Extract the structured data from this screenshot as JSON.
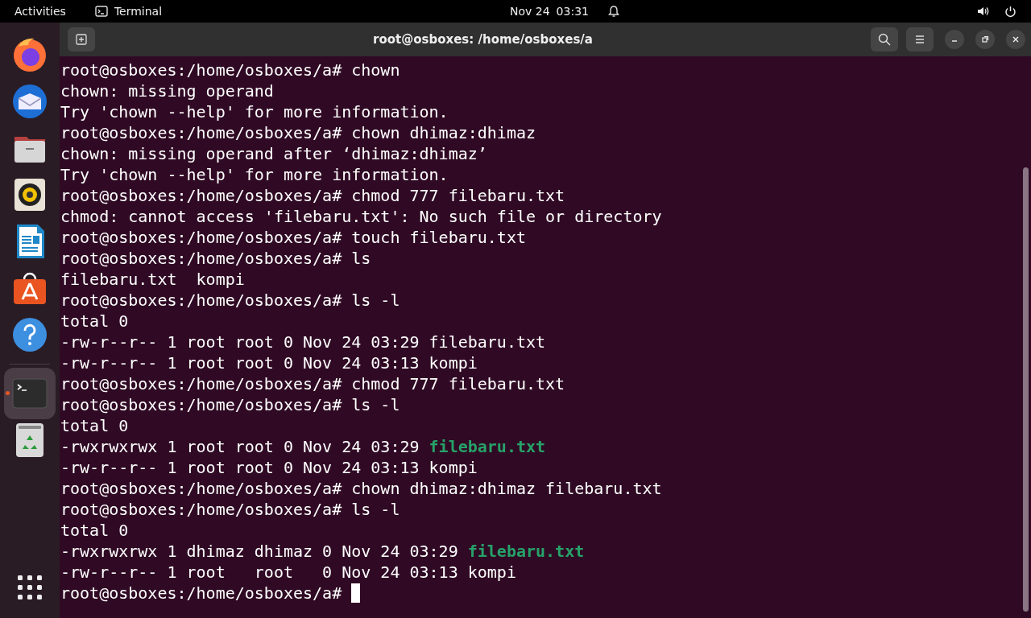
{
  "top_bar": {
    "activities": "Activities",
    "app_name": "Terminal",
    "date": "Nov 24",
    "time": "03:31"
  },
  "dock": {
    "items": [
      {
        "kind": "firefox",
        "selected": false,
        "running": false
      },
      {
        "kind": "mail",
        "selected": false,
        "running": false
      },
      {
        "kind": "files",
        "selected": false,
        "running": false
      },
      {
        "kind": "speaker",
        "selected": false,
        "running": false
      },
      {
        "kind": "writer",
        "selected": false,
        "running": false
      },
      {
        "kind": "store",
        "selected": false,
        "running": false
      },
      {
        "kind": "help",
        "selected": false,
        "running": false
      },
      {
        "kind": "terminal",
        "selected": true,
        "running": true
      },
      {
        "kind": "trash",
        "selected": false,
        "running": false
      }
    ]
  },
  "window": {
    "title": "root@osboxes: /home/osboxes/a"
  },
  "terminal": {
    "lines": [
      [
        {
          "kind": "plain",
          "text": "root@osboxes:/home/osboxes/a# chown"
        }
      ],
      [
        {
          "kind": "plain",
          "text": "chown: missing operand"
        }
      ],
      [
        {
          "kind": "plain",
          "text": "Try 'chown --help' for more information."
        }
      ],
      [
        {
          "kind": "plain",
          "text": "root@osboxes:/home/osboxes/a# chown dhimaz:dhimaz"
        }
      ],
      [
        {
          "kind": "plain",
          "text": "chown: missing operand after ‘dhimaz:dhimaz’"
        }
      ],
      [
        {
          "kind": "plain",
          "text": "Try 'chown --help' for more information."
        }
      ],
      [
        {
          "kind": "plain",
          "text": "root@osboxes:/home/osboxes/a# chmod 777 filebaru.txt"
        }
      ],
      [
        {
          "kind": "plain",
          "text": "chmod: cannot access 'filebaru.txt': No such file or directory"
        }
      ],
      [
        {
          "kind": "plain",
          "text": "root@osboxes:/home/osboxes/a# touch filebaru.txt"
        }
      ],
      [
        {
          "kind": "plain",
          "text": "root@osboxes:/home/osboxes/a# ls"
        }
      ],
      [
        {
          "kind": "plain",
          "text": "filebaru.txt  kompi"
        }
      ],
      [
        {
          "kind": "plain",
          "text": "root@osboxes:/home/osboxes/a# ls -l"
        }
      ],
      [
        {
          "kind": "plain",
          "text": "total 0"
        }
      ],
      [
        {
          "kind": "plain",
          "text": "-rw-r--r-- 1 root root 0 Nov 24 03:29 filebaru.txt"
        }
      ],
      [
        {
          "kind": "plain",
          "text": "-rw-r--r-- 1 root root 0 Nov 24 03:13 kompi"
        }
      ],
      [
        {
          "kind": "plain",
          "text": "root@osboxes:/home/osboxes/a# chmod 777 filebaru.txt"
        }
      ],
      [
        {
          "kind": "plain",
          "text": "root@osboxes:/home/osboxes/a# ls -l"
        }
      ],
      [
        {
          "kind": "plain",
          "text": "total 0"
        }
      ],
      [
        {
          "kind": "plain",
          "text": "-rwxrwxrwx 1 root root 0 Nov 24 03:29 "
        },
        {
          "kind": "executable",
          "text": "filebaru.txt"
        }
      ],
      [
        {
          "kind": "plain",
          "text": "-rw-r--r-- 1 root root 0 Nov 24 03:13 kompi"
        }
      ],
      [
        {
          "kind": "plain",
          "text": "root@osboxes:/home/osboxes/a# chown dhimaz:dhimaz filebaru.txt"
        }
      ],
      [
        {
          "kind": "plain",
          "text": "root@osboxes:/home/osboxes/a# ls -l"
        }
      ],
      [
        {
          "kind": "plain",
          "text": "total 0"
        }
      ],
      [
        {
          "kind": "plain",
          "text": "-rwxrwxrwx 1 dhimaz dhimaz 0 Nov 24 03:29 "
        },
        {
          "kind": "executable",
          "text": "filebaru.txt"
        }
      ],
      [
        {
          "kind": "plain",
          "text": "-rw-r--r-- 1 root   root   0 Nov 24 03:13 kompi"
        }
      ],
      [
        {
          "kind": "plain",
          "text": "root@osboxes:/home/osboxes/a# "
        }
      ]
    ],
    "cursor": true
  }
}
